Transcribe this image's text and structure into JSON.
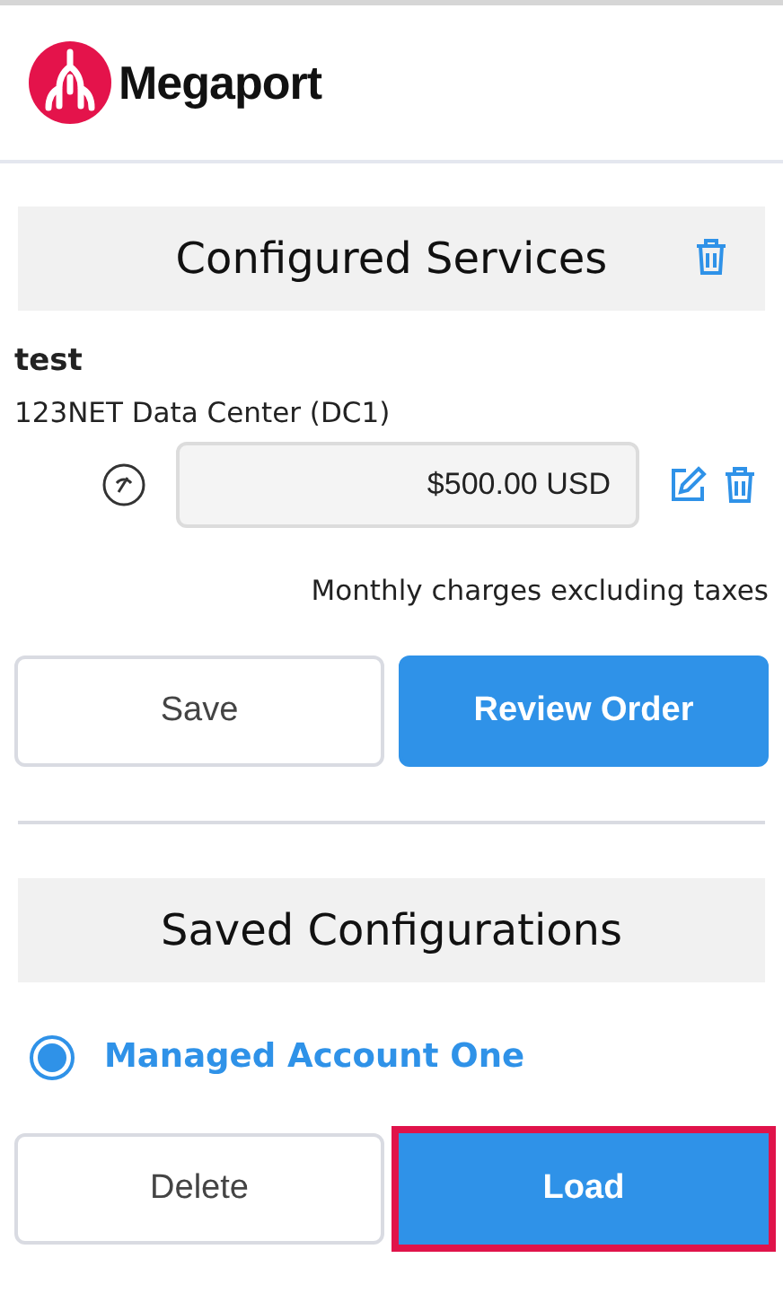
{
  "logo": {
    "text": "Megaport"
  },
  "configured_services": {
    "title": "Configured Services",
    "services": [
      {
        "name": "test",
        "location": "123NET Data Center (DC1)",
        "price": "$500.00 USD"
      }
    ],
    "note": "Monthly charges excluding taxes",
    "buttons": [
      {
        "label": "Save",
        "kind": "outline",
        "focused": false
      },
      {
        "label": "Review Order",
        "kind": "primary",
        "focused": false
      }
    ]
  },
  "saved_configurations": {
    "title": "Saved Configurations",
    "options": [
      {
        "label": "Managed Account One",
        "selected": true
      }
    ],
    "buttons": [
      {
        "label": "Delete",
        "kind": "outline",
        "focused": false
      },
      {
        "label": "Load",
        "kind": "primary",
        "focused": true
      }
    ]
  }
}
